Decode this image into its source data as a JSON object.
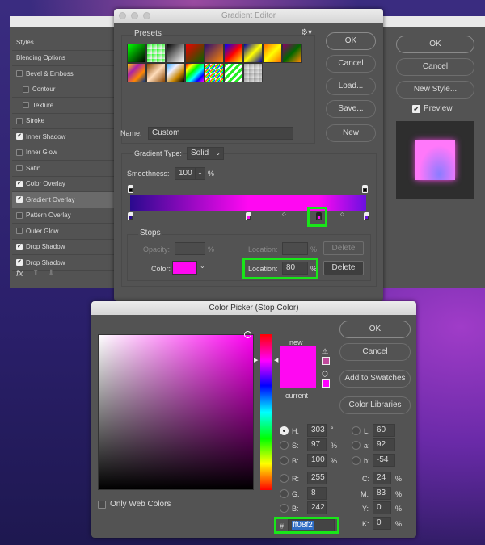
{
  "layer_style": {
    "items": [
      {
        "label": "Styles",
        "checkbox": null,
        "selected": false,
        "sub": false
      },
      {
        "label": "Blending Options",
        "checkbox": null,
        "selected": false,
        "sub": false
      },
      {
        "label": "Bevel & Emboss",
        "checkbox": false,
        "selected": false,
        "sub": false
      },
      {
        "label": "Contour",
        "checkbox": false,
        "selected": false,
        "sub": true
      },
      {
        "label": "Texture",
        "checkbox": false,
        "selected": false,
        "sub": true
      },
      {
        "label": "Stroke",
        "checkbox": false,
        "selected": false,
        "sub": false
      },
      {
        "label": "Inner Shadow",
        "checkbox": true,
        "selected": false,
        "sub": false
      },
      {
        "label": "Inner Glow",
        "checkbox": false,
        "selected": false,
        "sub": false
      },
      {
        "label": "Satin",
        "checkbox": false,
        "selected": false,
        "sub": false
      },
      {
        "label": "Color Overlay",
        "checkbox": true,
        "selected": false,
        "sub": false
      },
      {
        "label": "Gradient Overlay",
        "checkbox": true,
        "selected": true,
        "sub": false
      },
      {
        "label": "Pattern Overlay",
        "checkbox": false,
        "selected": false,
        "sub": false
      },
      {
        "label": "Outer Glow",
        "checkbox": false,
        "selected": false,
        "sub": false
      },
      {
        "label": "Drop Shadow",
        "checkbox": true,
        "selected": false,
        "sub": false
      },
      {
        "label": "Drop Shadow",
        "checkbox": true,
        "selected": false,
        "sub": false
      }
    ],
    "fx_label": "fx",
    "ok": "OK",
    "cancel": "Cancel",
    "new_style": "New Style...",
    "preview_label": "Preview",
    "preview_checked": true
  },
  "gradient_editor": {
    "title": "Gradient Editor",
    "presets_label": "Presets",
    "ok": "OK",
    "cancel": "Cancel",
    "load": "Load...",
    "save": "Save...",
    "new": "New",
    "name_label": "Name:",
    "name_value": "Custom",
    "type_label": "Gradient Type:",
    "type_value": "Solid",
    "smoothness_label": "Smoothness:",
    "smoothness_value": "100",
    "percent": "%",
    "stops_label": "Stops",
    "opacity_label": "Opacity:",
    "location_label": "Location:",
    "delete": "Delete",
    "color_label": "Color:",
    "color_value": "#ff08f2",
    "location_value": "80",
    "gradient_colors": [
      "#2a0a8e",
      "#ff08f2",
      "#ff08f2",
      "#6a10e0"
    ],
    "color_stops": [
      {
        "location": 0,
        "color": "#2a0a8e"
      },
      {
        "location": 50,
        "color": "#ff08f2"
      },
      {
        "location": 80,
        "color": "#ff08f2",
        "selected": true
      },
      {
        "location": 100,
        "color": "#6a10e0"
      }
    ]
  },
  "color_picker": {
    "title": "Color Picker (Stop Color)",
    "ok": "OK",
    "cancel": "Cancel",
    "add_swatches": "Add to Swatches",
    "color_libraries": "Color Libraries",
    "new_label": "new",
    "current_label": "current",
    "only_web": "Only Web Colors",
    "fields": {
      "H": "303",
      "S": "97",
      "B": "100",
      "R": "255",
      "G": "8",
      "B2": "242",
      "L": "60",
      "a": "92",
      "b": "-54",
      "C": "24",
      "M": "83",
      "Y": "0",
      "K": "0"
    },
    "units": {
      "deg": "°",
      "pct": "%"
    },
    "hash": "#",
    "hex": "ff08f2",
    "new_color": "#ff08f2",
    "current_color": "#ff08f2"
  }
}
